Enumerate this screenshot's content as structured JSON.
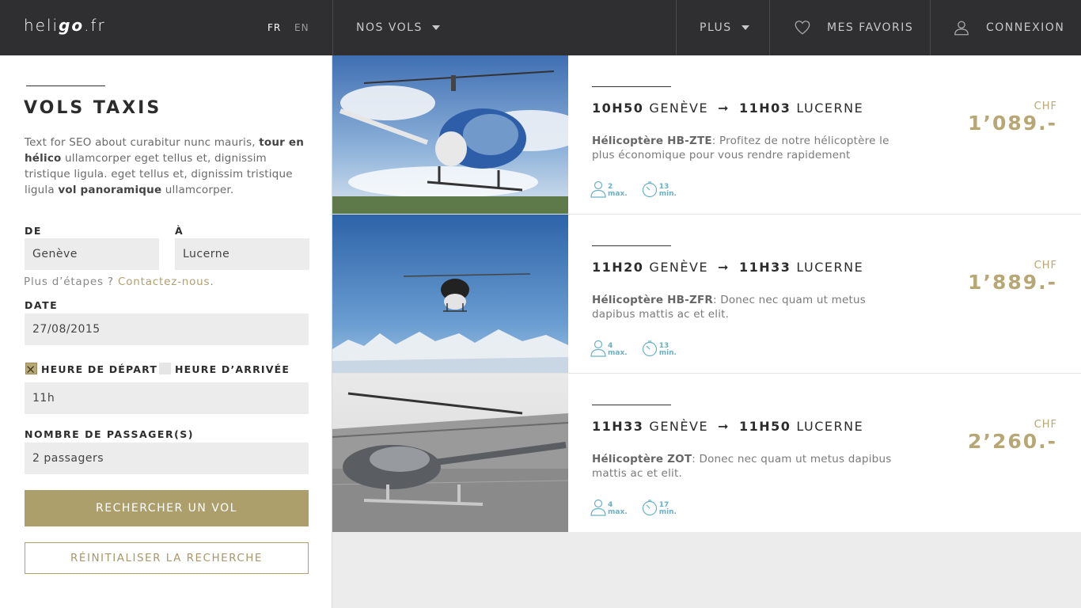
{
  "header": {
    "logo_pre": "heli",
    "logo_bold": "go",
    "logo_post": ".fr",
    "lang_fr": "FR",
    "lang_en": "EN",
    "nav_flights": "NOS VOLS",
    "nav_more": "PLUS",
    "nav_favorites": "MES FAVORIS",
    "nav_login": "CONNEXION"
  },
  "sidebar": {
    "title": "VOLS TAXIS",
    "intro_1": "Text for SEO about curabitur nunc mauris, ",
    "intro_b1": "tour en hélico",
    "intro_2": " ullamcorper eget tellus et, dignissim tristique ligula. eget tellus et, dignissim tristique ligula ",
    "intro_b2": "vol panoramique",
    "intro_3": " ullamcorper.",
    "from_label": "DE",
    "from_value": "Genève",
    "to_label": "À",
    "to_value": "Lucerne",
    "more_steps": "Plus d’étapes ?",
    "contact_link": "Contactez-nous",
    "date_label": "DATE",
    "date_value": "27/08/2015",
    "departure_label": "HEURE DE DÉPART",
    "arrival_label": "HEURE D’ARRIVÉE",
    "time_value": "11h",
    "passengers_label": "NOMBRE DE PASSAGER(S)",
    "passengers_value": "2 passagers",
    "search_button": "RECHERCHER UN VOL",
    "reset_button": "RÉINITIALISER LA RECHERCHE"
  },
  "results": [
    {
      "dep_time": "10H50",
      "dep_city": "GENÈVE",
      "arr_time": "11H03",
      "arr_city": "LUCERNE",
      "heli_name": "Hélicoptère HB-ZTE",
      "description": ": Profitez de notre hélicoptère le plus économique pour vous rendre rapidement",
      "pax": "2",
      "pax_unit": "max.",
      "duration": "13",
      "duration_unit": "min.",
      "currency": "CHF",
      "price": "1’089.-"
    },
    {
      "dep_time": "11H20",
      "dep_city": "GENÈVE",
      "arr_time": "11H33",
      "arr_city": "LUCERNE",
      "heli_name": "Hélicoptère HB-ZFR",
      "description": ": Donec nec quam ut metus dapibus mattis ac et elit.",
      "pax": "4",
      "pax_unit": "max.",
      "duration": "13",
      "duration_unit": "min.",
      "currency": "CHF",
      "price": "1’889.-"
    },
    {
      "dep_time": "11H33",
      "dep_city": "GENÈVE",
      "arr_time": "11H50",
      "arr_city": "LUCERNE",
      "heli_name": "Hélicoptère ZOT",
      "description": ": Donec nec quam ut metus dapibus mattis ac et elit.",
      "pax": "4",
      "pax_unit": "max.",
      "duration": "17",
      "duration_unit": "min.",
      "currency": "CHF",
      "price": "2’260.-"
    }
  ],
  "colors": {
    "accent": "#ad9f6b",
    "header_bg": "#2f2f31",
    "icon_teal": "#6ab0c4"
  },
  "icons": [
    "chevron-down-icon",
    "heart-icon",
    "user-icon",
    "check-icon",
    "arrow-right-icon",
    "passenger-icon",
    "clock-icon"
  ]
}
